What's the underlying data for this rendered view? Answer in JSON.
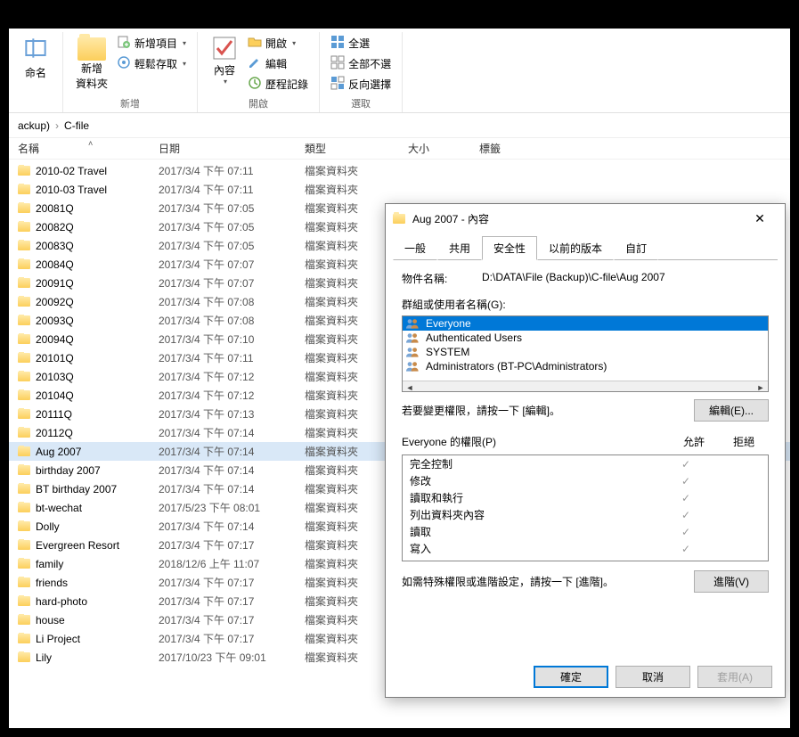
{
  "ribbon": {
    "rename_label": "命名",
    "new_folder_label": "新增\n資料夾",
    "new_item_label": "新增項目",
    "easy_access_label": "輕鬆存取",
    "group_new": "新增",
    "properties_label": "內容",
    "open_label": "開啟",
    "edit_label": "編輯",
    "history_label": "歷程記錄",
    "group_open": "開啟",
    "select_all_label": "全選",
    "select_none_label": "全部不選",
    "invert_selection_label": "反向選擇",
    "group_select": "選取"
  },
  "breadcrumb": {
    "seg0": "ackup)",
    "seg1": "C-file"
  },
  "columns": {
    "name": "名稱",
    "date": "日期",
    "type": "類型",
    "size": "大小",
    "tags": "標籤"
  },
  "files": [
    {
      "name": "2010-02 Travel",
      "date": "2017/3/4 下午 07:11",
      "type": "檔案資料夾"
    },
    {
      "name": "2010-03 Travel",
      "date": "2017/3/4 下午 07:11",
      "type": "檔案資料夾"
    },
    {
      "name": "20081Q",
      "date": "2017/3/4 下午 07:05",
      "type": "檔案資料夾"
    },
    {
      "name": "20082Q",
      "date": "2017/3/4 下午 07:05",
      "type": "檔案資料夾"
    },
    {
      "name": "20083Q",
      "date": "2017/3/4 下午 07:05",
      "type": "檔案資料夾"
    },
    {
      "name": "20084Q",
      "date": "2017/3/4 下午 07:07",
      "type": "檔案資料夾"
    },
    {
      "name": "20091Q",
      "date": "2017/3/4 下午 07:07",
      "type": "檔案資料夾"
    },
    {
      "name": "20092Q",
      "date": "2017/3/4 下午 07:08",
      "type": "檔案資料夾"
    },
    {
      "name": "20093Q",
      "date": "2017/3/4 下午 07:08",
      "type": "檔案資料夾"
    },
    {
      "name": "20094Q",
      "date": "2017/3/4 下午 07:10",
      "type": "檔案資料夾"
    },
    {
      "name": "20101Q",
      "date": "2017/3/4 下午 07:11",
      "type": "檔案資料夾"
    },
    {
      "name": "20103Q",
      "date": "2017/3/4 下午 07:12",
      "type": "檔案資料夾"
    },
    {
      "name": "20104Q",
      "date": "2017/3/4 下午 07:12",
      "type": "檔案資料夾"
    },
    {
      "name": "20111Q",
      "date": "2017/3/4 下午 07:13",
      "type": "檔案資料夾"
    },
    {
      "name": "20112Q",
      "date": "2017/3/4 下午 07:14",
      "type": "檔案資料夾"
    },
    {
      "name": "Aug 2007",
      "date": "2017/3/4 下午 07:14",
      "type": "檔案資料夾",
      "selected": true
    },
    {
      "name": "birthday 2007",
      "date": "2017/3/4 下午 07:14",
      "type": "檔案資料夾"
    },
    {
      "name": "BT birthday 2007",
      "date": "2017/3/4 下午 07:14",
      "type": "檔案資料夾"
    },
    {
      "name": "bt-wechat",
      "date": "2017/5/23 下午 08:01",
      "type": "檔案資料夾"
    },
    {
      "name": "Dolly",
      "date": "2017/3/4 下午 07:14",
      "type": "檔案資料夾"
    },
    {
      "name": "Evergreen Resort",
      "date": "2017/3/4 下午 07:17",
      "type": "檔案資料夾"
    },
    {
      "name": "family",
      "date": "2018/12/6 上午 11:07",
      "type": "檔案資料夾"
    },
    {
      "name": "friends",
      "date": "2017/3/4 下午 07:17",
      "type": "檔案資料夾"
    },
    {
      "name": "hard-photo",
      "date": "2017/3/4 下午 07:17",
      "type": "檔案資料夾"
    },
    {
      "name": "house",
      "date": "2017/3/4 下午 07:17",
      "type": "檔案資料夾"
    },
    {
      "name": "Li Project",
      "date": "2017/3/4 下午 07:17",
      "type": "檔案資料夾"
    },
    {
      "name": "Lily",
      "date": "2017/10/23 下午 09:01",
      "type": "檔案資料夾"
    }
  ],
  "dialog": {
    "title": "Aug 2007 - 內容",
    "tabs": {
      "general": "一般",
      "sharing": "共用",
      "security": "安全性",
      "prev": "以前的版本",
      "custom": "自訂"
    },
    "object_name_label": "物件名稱:",
    "object_name": "D:\\DATA\\File (Backup)\\C-file\\Aug 2007",
    "groups_label": "群組或使用者名稱(G):",
    "groups": [
      {
        "name": "Everyone",
        "selected": true
      },
      {
        "name": "Authenticated Users"
      },
      {
        "name": "SYSTEM"
      },
      {
        "name": "Administrators (BT-PC\\Administrators)"
      }
    ],
    "edit_hint": "若要變更權限，請按一下 [編輯]。",
    "edit_button": "編輯(E)...",
    "perms_for_label": "Everyone 的權限(P)",
    "perm_allow": "允許",
    "perm_deny": "拒絕",
    "perms": [
      {
        "name": "完全控制",
        "allow": true
      },
      {
        "name": "修改",
        "allow": true
      },
      {
        "name": "讀取和執行",
        "allow": true
      },
      {
        "name": "列出資料夾內容",
        "allow": true
      },
      {
        "name": "讀取",
        "allow": true
      },
      {
        "name": "寫入",
        "allow": true
      }
    ],
    "advanced_hint": "如需特殊權限或進階設定，請按一下 [進階]。",
    "advanced_button": "進階(V)",
    "ok": "確定",
    "cancel": "取消",
    "apply": "套用(A)"
  }
}
